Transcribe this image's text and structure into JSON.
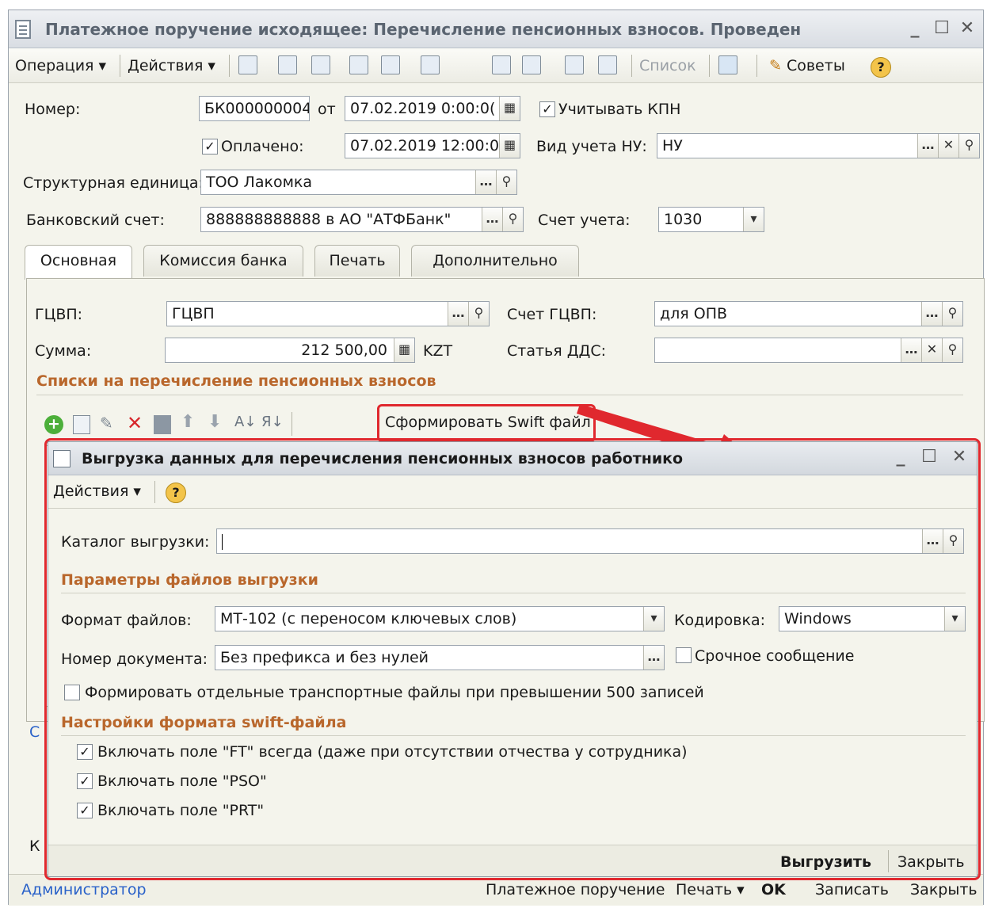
{
  "main_window": {
    "title": "Платежное поручение исходящее: Перечисление пенсионных взносов. Проведен",
    "toolbar": {
      "operation": "Операция",
      "actions": "Действия",
      "list": "Список",
      "tips": "Советы"
    },
    "form": {
      "number_label": "Номер:",
      "number_value": "БК000000004",
      "from_label": "от",
      "date_value": "07.02.2019 0:00:0(",
      "kpn_label": "Учитывать КПН",
      "paid_label": "Оплачено:",
      "paid_date": "07.02.2019 12:00:0",
      "nu_label": "Вид учета НУ:",
      "nu_value": "НУ",
      "struct_label": "Структурная единица:",
      "struct_value": "ТОО Лакомка",
      "bank_label": "Банковский счет:",
      "bank_value": "888888888888 в АО \"АТФБанк\"",
      "account_label": "Счет учета:",
      "account_value": "1030"
    },
    "tabs": [
      "Основная",
      "Комиссия банка",
      "Печать",
      "Дополнительно"
    ],
    "main_tab": {
      "gcvp_label": "ГЦВП:",
      "gcvp_value": "ГЦВП",
      "gcvp_account_label": "Счет ГЦВП:",
      "gcvp_account_value": "для ОПВ",
      "sum_label": "Сумма:",
      "sum_value": "212 500,00",
      "currency": "KZT",
      "dds_label": "Статья ДДС:",
      "dds_value": "",
      "lists_title": "Списки на перечисление пенсионных взносов",
      "swift_button": "Сформировать Swift файл"
    },
    "hidden_fragments": {
      "left_c": "С",
      "left_k": "К"
    },
    "footer": {
      "user": "Администратор",
      "payment_order": "Платежное поручение",
      "print": "Печать",
      "ok": "OK",
      "save": "Записать",
      "close": "Закрыть"
    }
  },
  "dialog": {
    "title": "Выгрузка данных для перечисления пенсионных взносов работнико",
    "actions": "Действия",
    "catalog_label": "Каталог выгрузки:",
    "catalog_value": "",
    "params_title": "Параметры файлов выгрузки",
    "format_label": "Формат файлов:",
    "format_value": "МТ-102 (с переносом ключевых слов)",
    "encoding_label": "Кодировка:",
    "encoding_value": "Windows",
    "docnum_label": "Номер документа:",
    "docnum_value": "Без префикса и без нулей",
    "urgent_label": "Срочное сообщение",
    "separate_files_label": "Формировать отдельные транспортные файлы при превышении 500 записей",
    "swift_settings_title": "Настройки формата swift-файла",
    "check_ft": "Включать поле \"FT\" всегда (даже при отсутствии отчества у сотрудника)",
    "check_pso": "Включать поле \"PSO\"",
    "check_prt": "Включать поле \"PRT\"",
    "export_button": "Выгрузить",
    "close_button": "Закрыть"
  },
  "colors": {
    "section_title": "#b9672c",
    "highlight_red": "#e0282e"
  }
}
